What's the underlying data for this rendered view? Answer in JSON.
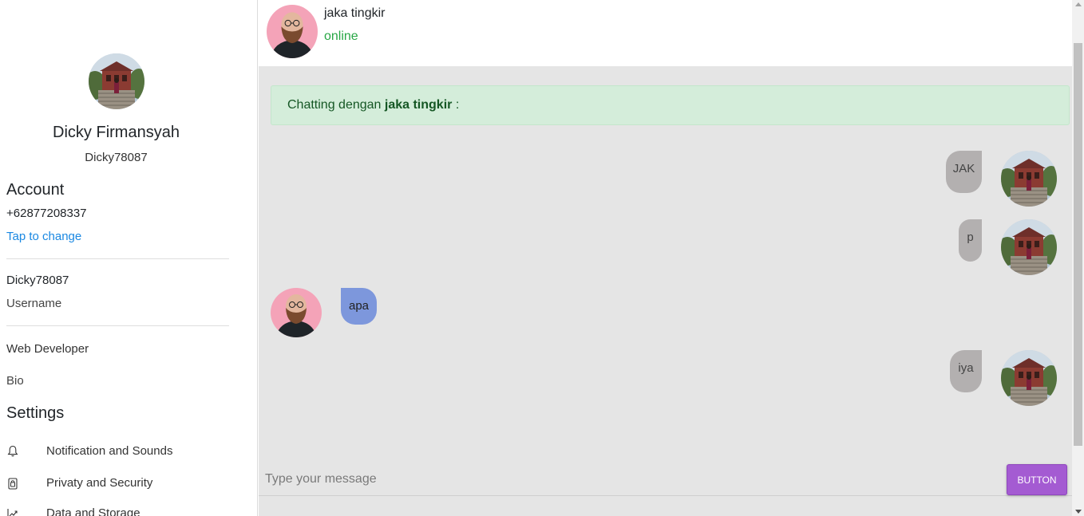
{
  "profile": {
    "name": "Dicky Firmansyah",
    "handle": "Dicky78087"
  },
  "account": {
    "title": "Account",
    "phone": "+62877208337",
    "change_label": "Tap to change",
    "username_value": "Dicky78087",
    "username_label": "Username",
    "bio_value": "Web Developer",
    "bio_label": "Bio"
  },
  "settings": {
    "title": "Settings",
    "items": [
      {
        "label": "Notification and Sounds",
        "icon": "bell-icon"
      },
      {
        "label": "Privaty and Security",
        "icon": "lock-icon"
      },
      {
        "label": "Data and Storage",
        "icon": "chart-icon"
      }
    ]
  },
  "chat": {
    "contact_name": "jaka tingkir",
    "status": "online",
    "status_color": "#28a745",
    "banner_prefix": "Chatting dengan",
    "banner_name": "jaka tingkir",
    "banner_suffix": " :",
    "messages": [
      {
        "text": "JAK",
        "direction": "outgoing"
      },
      {
        "text": "p",
        "direction": "outgoing"
      },
      {
        "text": "apa",
        "direction": "incoming"
      },
      {
        "text": "iya",
        "direction": "outgoing"
      }
    ],
    "input_placeholder": "Type your message",
    "send_label": "BUTTON",
    "accent": "#a45bd2"
  }
}
